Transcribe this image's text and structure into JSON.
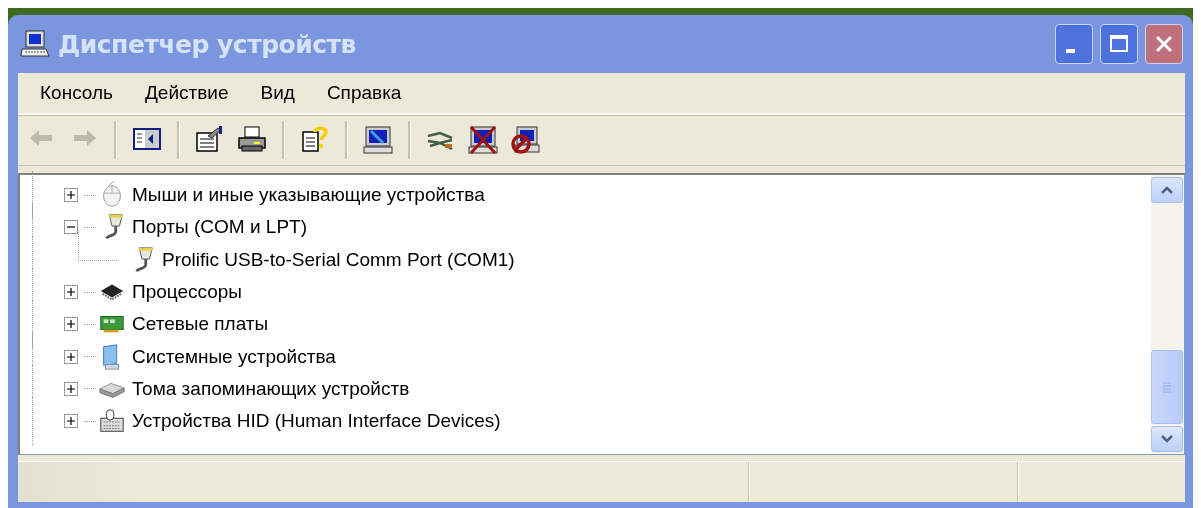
{
  "window": {
    "title": "Диспетчер устройств"
  },
  "menu": [
    {
      "label": "Консоль"
    },
    {
      "label": "Действие"
    },
    {
      "label": "Вид"
    },
    {
      "label": "Справка"
    }
  ],
  "toolbar": [
    {
      "kind": "back",
      "disabled": true
    },
    {
      "kind": "forward",
      "disabled": true
    },
    {
      "kind": "sep"
    },
    {
      "kind": "tree"
    },
    {
      "kind": "sep"
    },
    {
      "kind": "properties",
      "disabled": false
    },
    {
      "kind": "print",
      "disabled": false
    },
    {
      "kind": "sep"
    },
    {
      "kind": "help",
      "disabled": false
    },
    {
      "kind": "sep"
    },
    {
      "kind": "scan",
      "disabled": false
    },
    {
      "kind": "sep"
    },
    {
      "kind": "update",
      "disabled": false
    },
    {
      "kind": "uninstall",
      "disabled": false
    },
    {
      "kind": "disable",
      "disabled": false
    }
  ],
  "tree": [
    {
      "label": "Мыши и иные указывающие устройства",
      "kind": "mouse",
      "expanded": false
    },
    {
      "label": "Порты (COM и LPT)",
      "kind": "port",
      "expanded": true,
      "children": [
        {
          "label": "Prolific USB-to-Serial Comm Port (COM1)",
          "kind": "port"
        }
      ]
    },
    {
      "label": "Процессоры",
      "kind": "chip",
      "expanded": false
    },
    {
      "label": "Сетевые платы",
      "kind": "netcard",
      "expanded": false
    },
    {
      "label": "Системные устройства",
      "kind": "system",
      "expanded": false
    },
    {
      "label": "Тома запоминающих устройств",
      "kind": "disk",
      "expanded": false
    },
    {
      "label": "Устройства HID (Human Interface Devices)",
      "kind": "hid",
      "expanded": false
    }
  ]
}
